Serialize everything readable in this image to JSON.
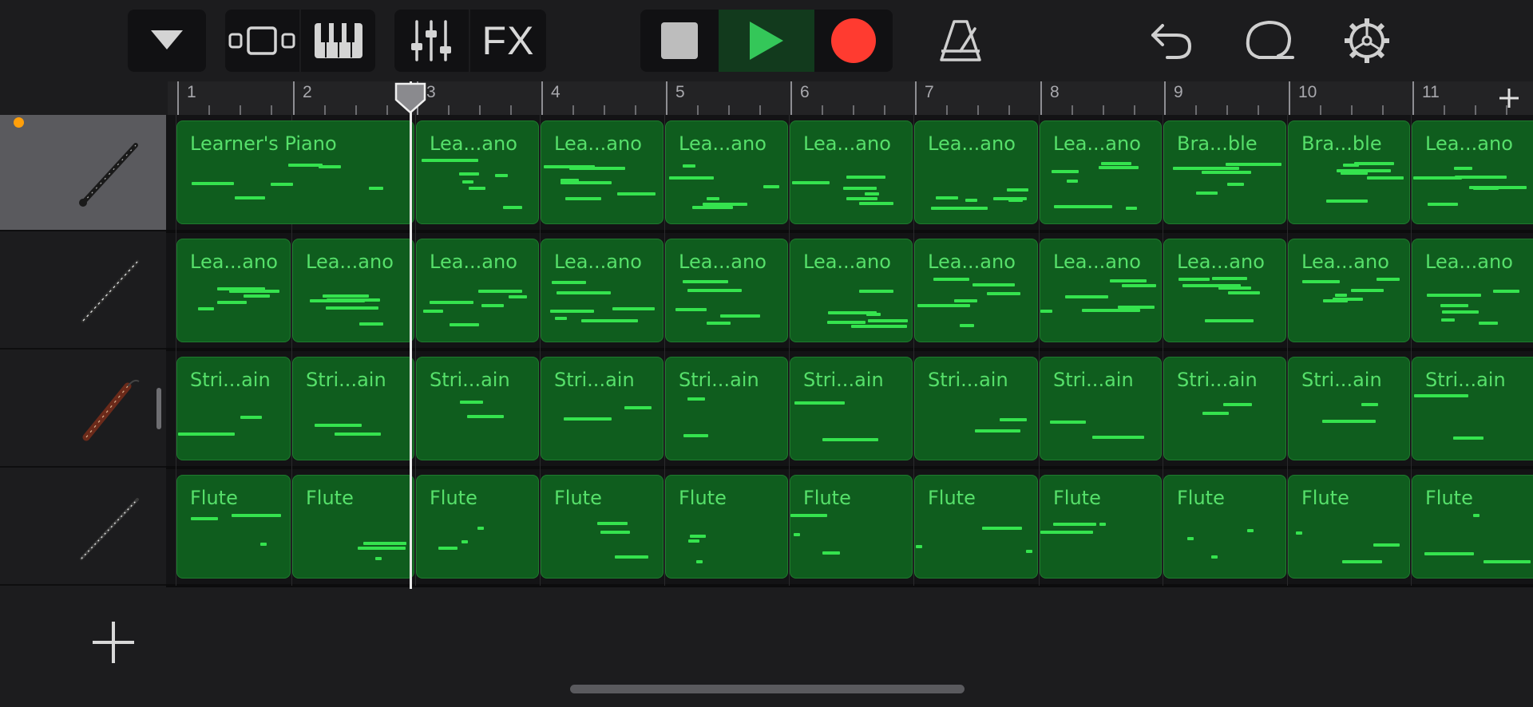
{
  "toolbar": {
    "accent_record": "#ff3b30",
    "accent_play": "#34c759",
    "icons": {
      "tracks_menu": "chevron-down-icon",
      "view_toggle": "tracks-view-icon",
      "keyboard": "piano-keys-icon",
      "mixer": "mixer-sliders-icon",
      "stop": "stop-icon",
      "play": "play-icon",
      "record": "record-icon",
      "metronome": "metronome-icon",
      "undo": "undo-icon",
      "loop_browser": "loop-icon",
      "settings": "gear-icon"
    },
    "fx_label": "FX"
  },
  "ruler": {
    "bars": [
      "1",
      "2",
      "3",
      "4",
      "5",
      "6",
      "7",
      "8",
      "9",
      "10",
      "11"
    ],
    "add_section_label": "+"
  },
  "tracks": [
    {
      "instrument": "clarinet",
      "selected": true,
      "regions": [
        "Learner's Piano",
        "Lea...ano",
        "Lea...ano",
        "Lea...ano",
        "Lea...ano",
        "Lea...ano",
        "Lea...ano",
        "Bra...ble",
        "Bra...ble",
        "Lea...ano"
      ]
    },
    {
      "instrument": "oboe",
      "selected": false,
      "regions": [
        "Lea...ano",
        "Lea...ano",
        "Lea...ano",
        "Lea...ano",
        "Lea...ano",
        "Lea...ano",
        "Lea...ano",
        "Lea...ano",
        "Lea...ano",
        "Lea...ano",
        "Lea...ano"
      ]
    },
    {
      "instrument": "bassoon",
      "selected": false,
      "regions": [
        "Stri...ain",
        "Stri...ain",
        "Stri...ain",
        "Stri...ain",
        "Stri...ain",
        "Stri...ain",
        "Stri...ain",
        "Stri...ain",
        "Stri...ain",
        "Stri...ain",
        "Stri...ain"
      ]
    },
    {
      "instrument": "flute",
      "selected": false,
      "regions": [
        "Flute",
        "Flute",
        "Flute",
        "Flute",
        "Flute",
        "Flute",
        "Flute",
        "Flute",
        "Flute",
        "Flute",
        "Flute"
      ]
    }
  ],
  "add_track_label": "+"
}
